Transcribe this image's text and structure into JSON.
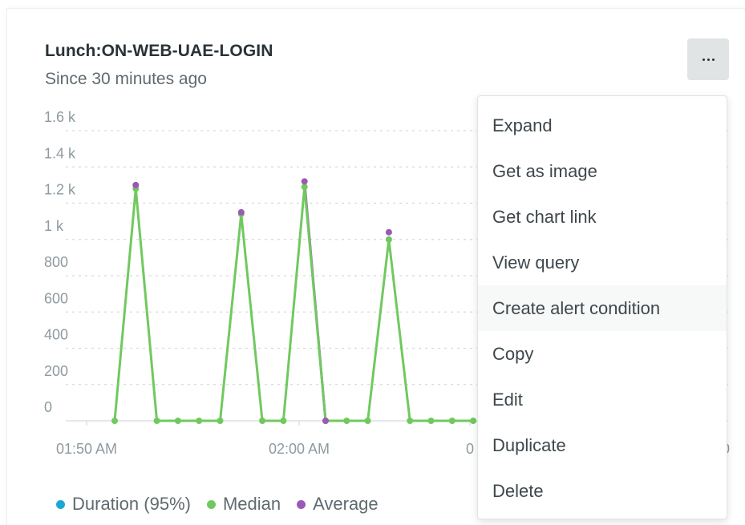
{
  "card": {
    "title": "Lunch:ON-WEB-UAE-LOGIN",
    "subtitle": "Since 30 minutes ago"
  },
  "menu": {
    "items": [
      "Expand",
      "Get as image",
      "Get chart link",
      "View query",
      "Create alert condition",
      "Copy",
      "Edit",
      "Duplicate",
      "Delete"
    ],
    "hovered_index": 4
  },
  "icons": {
    "more": "ellipsis-icon"
  },
  "colors": {
    "duration": "#1ea7d6",
    "median": "#70c95f",
    "average": "#9b59b6",
    "grid": "#d5dadc",
    "tick": "#8e9aa0"
  },
  "chart_data": {
    "type": "line",
    "y_ticks": [
      "1.6 k",
      "1.4 k",
      "1.2 k",
      "1 k",
      "800",
      "600",
      "400",
      "200",
      "0"
    ],
    "x_ticks": [
      "01:50 AM",
      "02:00 AM",
      "0",
      "0"
    ],
    "ylim": [
      0,
      1600
    ],
    "x": [
      "01:51",
      "01:52",
      "01:53",
      "01:54",
      "01:55",
      "01:56",
      "01:57",
      "01:58",
      "01:59",
      "02:00",
      "02:01",
      "02:02",
      "02:03",
      "02:04",
      "02:05",
      "02:06",
      "02:07",
      "02:08"
    ],
    "series": [
      {
        "name": "Duration (95%)",
        "values": []
      },
      {
        "name": "Median",
        "values": [
          0,
          1280,
          0,
          0,
          0,
          0,
          1140,
          0,
          0,
          1290,
          0,
          0,
          0,
          1000,
          0,
          0,
          0,
          0
        ]
      },
      {
        "name": "Average",
        "values": [
          null,
          1300,
          null,
          null,
          null,
          null,
          1150,
          null,
          null,
          1320,
          0,
          null,
          null,
          1040,
          null,
          null,
          null,
          null
        ]
      }
    ],
    "grid": true,
    "legend": "bottom-left"
  }
}
